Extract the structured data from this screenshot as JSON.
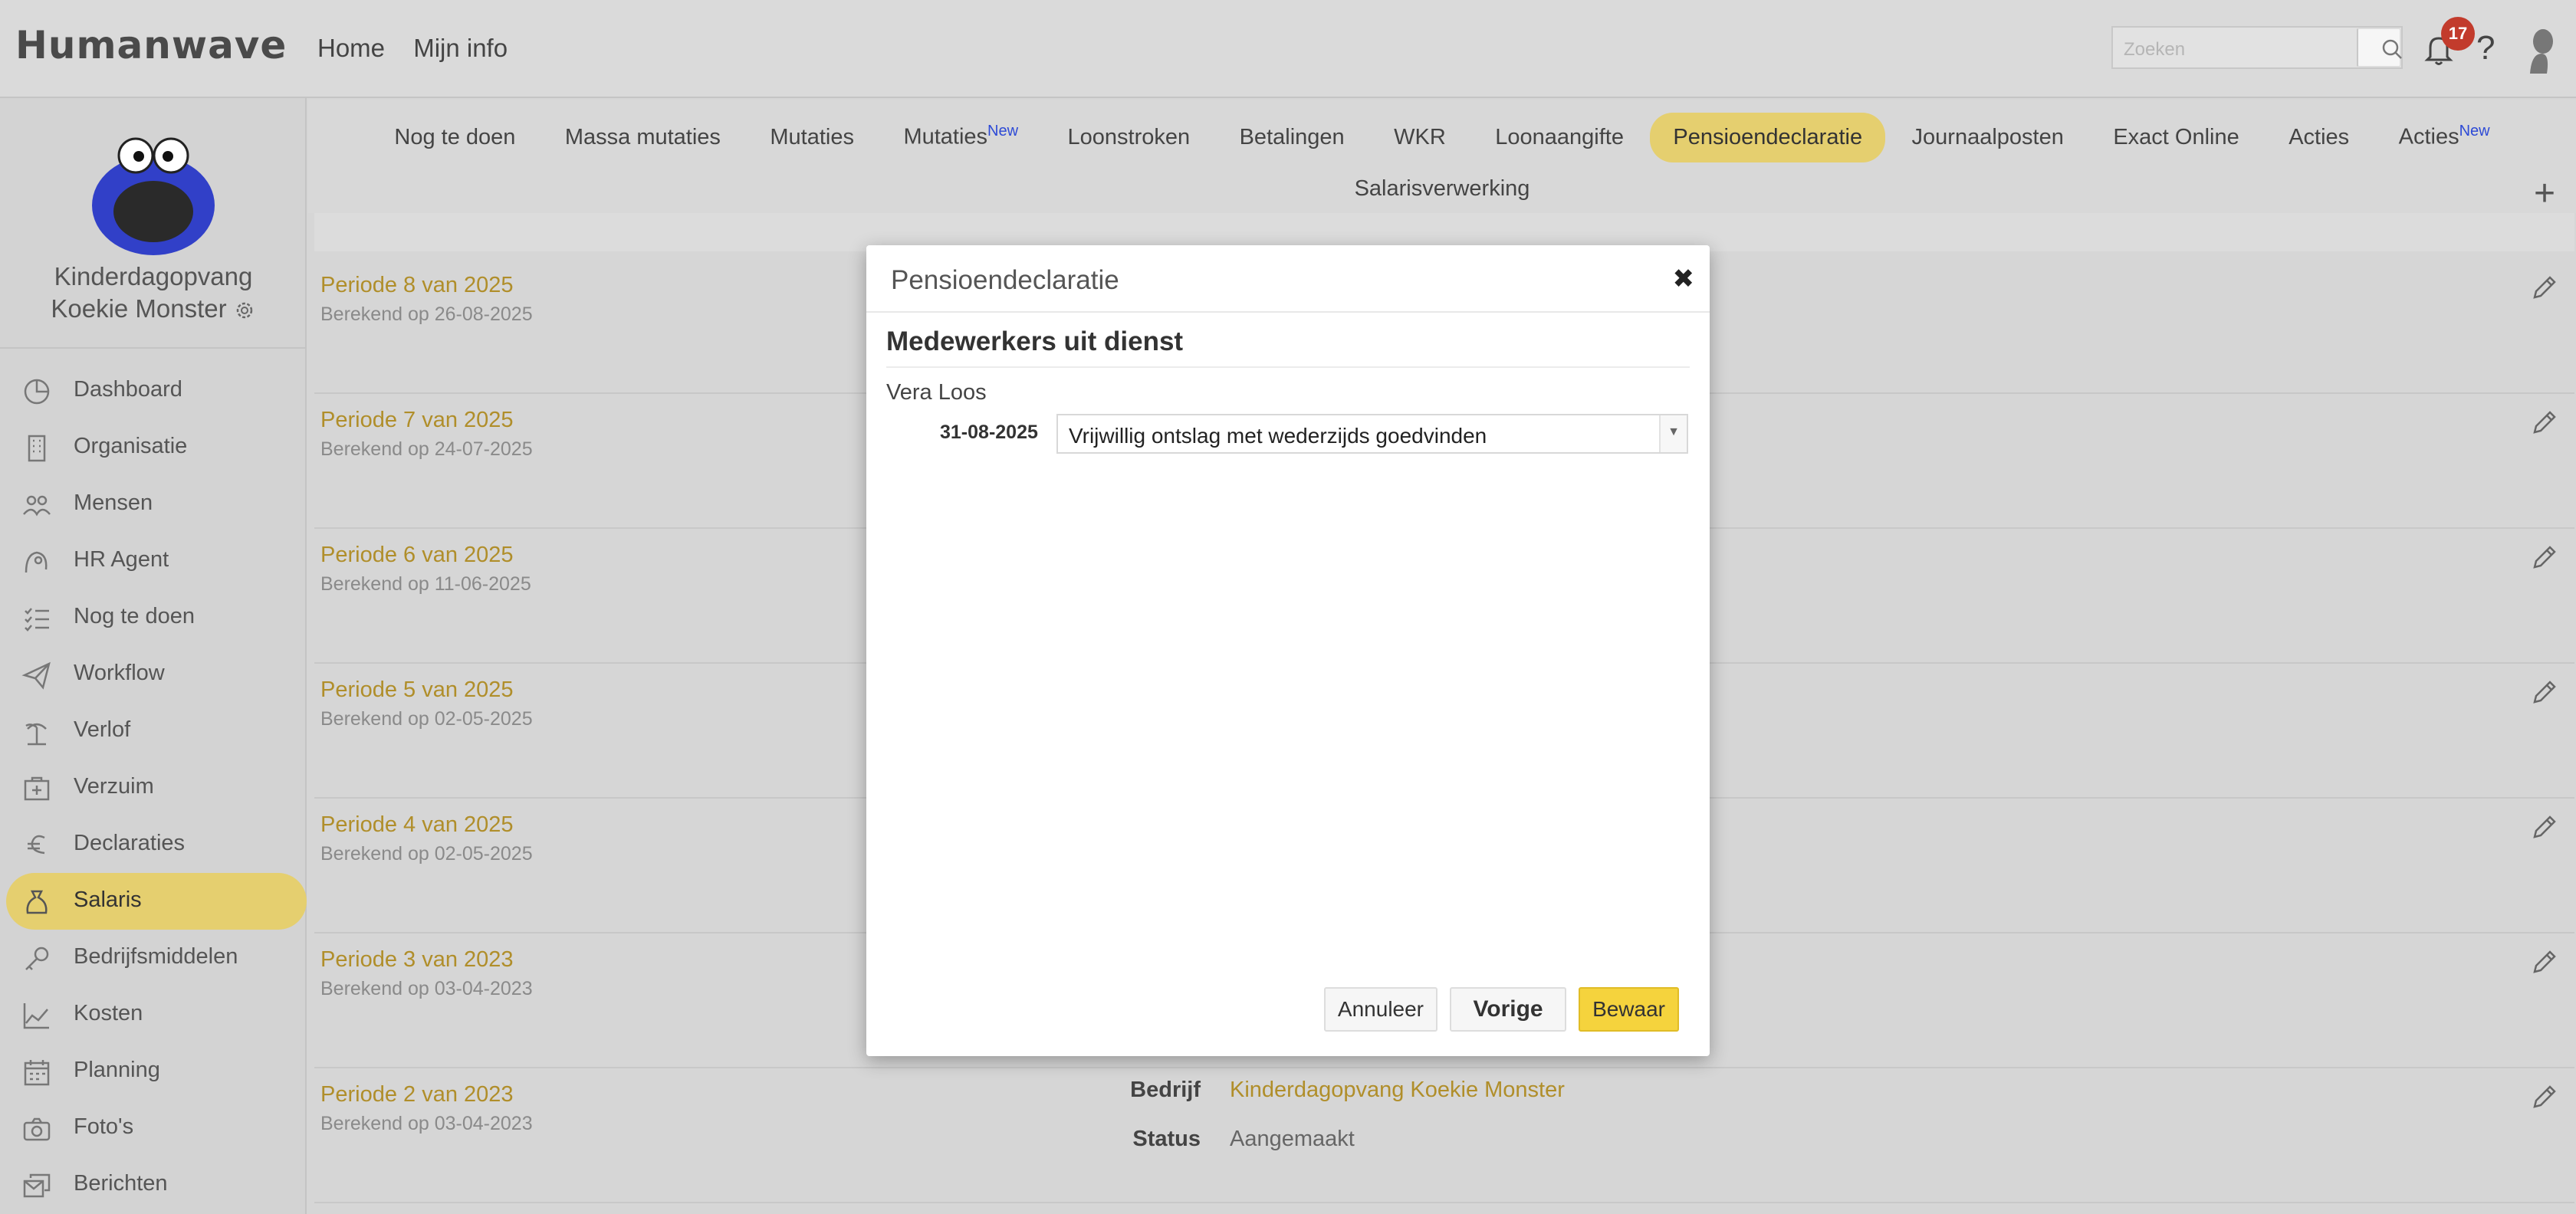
{
  "app": {
    "logo": "Humanwave"
  },
  "topnav": {
    "home": "Home",
    "myinfo": "Mijn info"
  },
  "search": {
    "placeholder": "Zoeken"
  },
  "notifications": {
    "count": "17"
  },
  "help": "?",
  "company": {
    "line1": "Kinderdagopvang",
    "line2": "Koekie Monster"
  },
  "sidebar": {
    "items": [
      {
        "label": "Dashboard",
        "icon": "pie-chart-icon"
      },
      {
        "label": "Organisatie",
        "icon": "building-icon"
      },
      {
        "label": "Mensen",
        "icon": "people-icon"
      },
      {
        "label": "HR Agent",
        "icon": "agent-icon"
      },
      {
        "label": "Nog te doen",
        "icon": "checklist-icon"
      },
      {
        "label": "Workflow",
        "icon": "paper-plane-icon"
      },
      {
        "label": "Verlof",
        "icon": "palm-tree-icon"
      },
      {
        "label": "Verzuim",
        "icon": "medical-kit-icon"
      },
      {
        "label": "Declaraties",
        "icon": "euro-icon"
      },
      {
        "label": "Salaris",
        "icon": "money-bag-icon"
      },
      {
        "label": "Bedrijfsmiddelen",
        "icon": "key-icon"
      },
      {
        "label": "Kosten",
        "icon": "area-chart-icon"
      },
      {
        "label": "Planning",
        "icon": "calendar-icon"
      },
      {
        "label": "Foto's",
        "icon": "camera-icon"
      },
      {
        "label": "Berichten",
        "icon": "messages-icon"
      }
    ]
  },
  "tabs": {
    "row1": [
      "Nog te doen",
      "Massa mutaties",
      "Mutaties",
      "Mutaties",
      "Loonstroken",
      "Betalingen",
      "WKR",
      "Loonaangifte",
      "Pensioendeclaratie",
      "Journaalposten",
      "Exact Online",
      "Acties",
      "Acties"
    ],
    "new_badge": "New",
    "row2": "Salarisverwerking",
    "add": "+"
  },
  "periods": [
    {
      "title": "Periode 8 van 2025",
      "sub": "Berekend op 26-08-2025"
    },
    {
      "title": "Periode 7 van 2025",
      "sub": "Berekend op 24-07-2025"
    },
    {
      "title": "Periode 6 van 2025",
      "sub": "Berekend op 11-06-2025"
    },
    {
      "title": "Periode 5 van 2025",
      "sub": "Berekend op 02-05-2025"
    },
    {
      "title": "Periode 4 van 2025",
      "sub": "Berekend op 02-05-2025"
    },
    {
      "title": "Periode 3 van 2023",
      "sub": "Berekend op 03-04-2023"
    },
    {
      "title": "Periode 2 van 2023",
      "sub": "Berekend op 03-04-2023"
    }
  ],
  "period_details": {
    "company_label": "Bedrijf",
    "company_value": "Kinderdagopvang Koekie Monster",
    "status_label": "Status",
    "status_value": "Aangemaakt"
  },
  "modal": {
    "title": "Pensioendeclaratie",
    "close": "✖",
    "section": "Medewerkers uit dienst",
    "employee": "Vera Loos",
    "date": "31-08-2025",
    "reason": "Vrijwillig ontslag met wederzijds goedvinden",
    "cancel": "Annuleer",
    "prev": "Vorige",
    "save": "Bewaar"
  },
  "colors": {
    "accent": "#e5cf6f",
    "link": "#b08e2a",
    "save": "#f5d33d",
    "badge": "#c23b2c"
  }
}
